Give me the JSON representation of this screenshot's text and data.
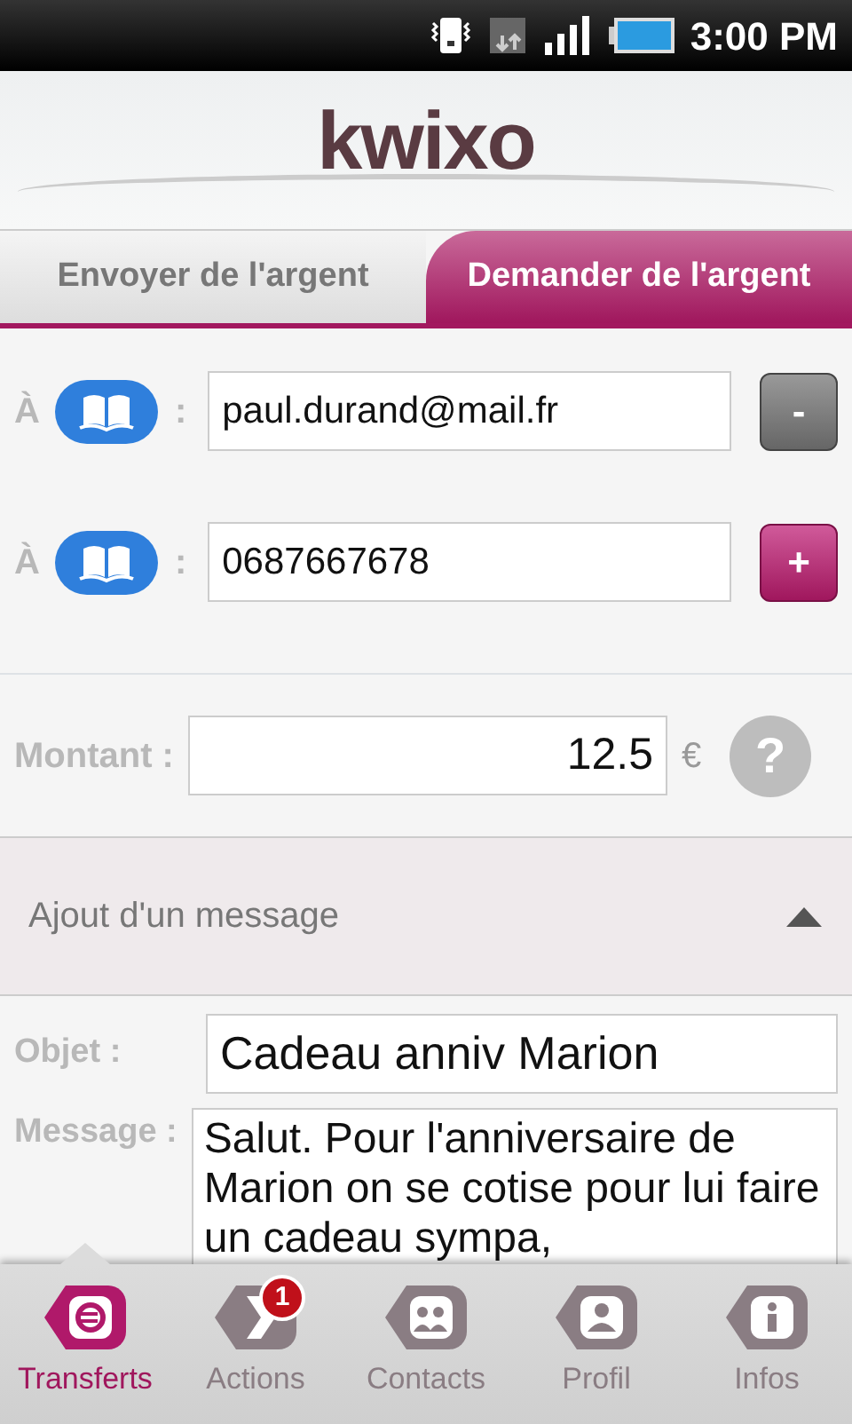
{
  "status_bar": {
    "time": "3:00 PM"
  },
  "header": {
    "logo": "kwixo"
  },
  "tabs": [
    {
      "label": "Envoyer de l'argent",
      "selected": false
    },
    {
      "label": "Demander de l'argent",
      "selected": true
    }
  ],
  "recipients": [
    {
      "label": "À",
      "separator": ":",
      "value": "paul.durand@mail.fr",
      "action": "-",
      "kind": "remove"
    },
    {
      "label": "À",
      "separator": ":",
      "value": "0687667678",
      "action": "+",
      "kind": "add"
    }
  ],
  "amount": {
    "label": "Montant :",
    "value": "12.5",
    "currency": "€",
    "help": "?"
  },
  "message_section": {
    "title": "Ajout d'un message",
    "expanded": true,
    "subject_label": "Objet :",
    "subject": "Cadeau anniv Marion",
    "message_label": "Message :",
    "message": "Salut. Pour l'anniversaire de Marion on se cotise pour lui faire un cadeau sympa,"
  },
  "bottom_nav": [
    {
      "label": "Transferts",
      "kind": "euro",
      "selected": true
    },
    {
      "label": "Actions",
      "kind": "chevron",
      "selected": false,
      "badge": "1"
    },
    {
      "label": "Contacts",
      "kind": "people",
      "selected": false
    },
    {
      "label": "Profil",
      "kind": "person",
      "selected": false
    },
    {
      "label": "Infos",
      "kind": "info",
      "selected": false
    }
  ]
}
